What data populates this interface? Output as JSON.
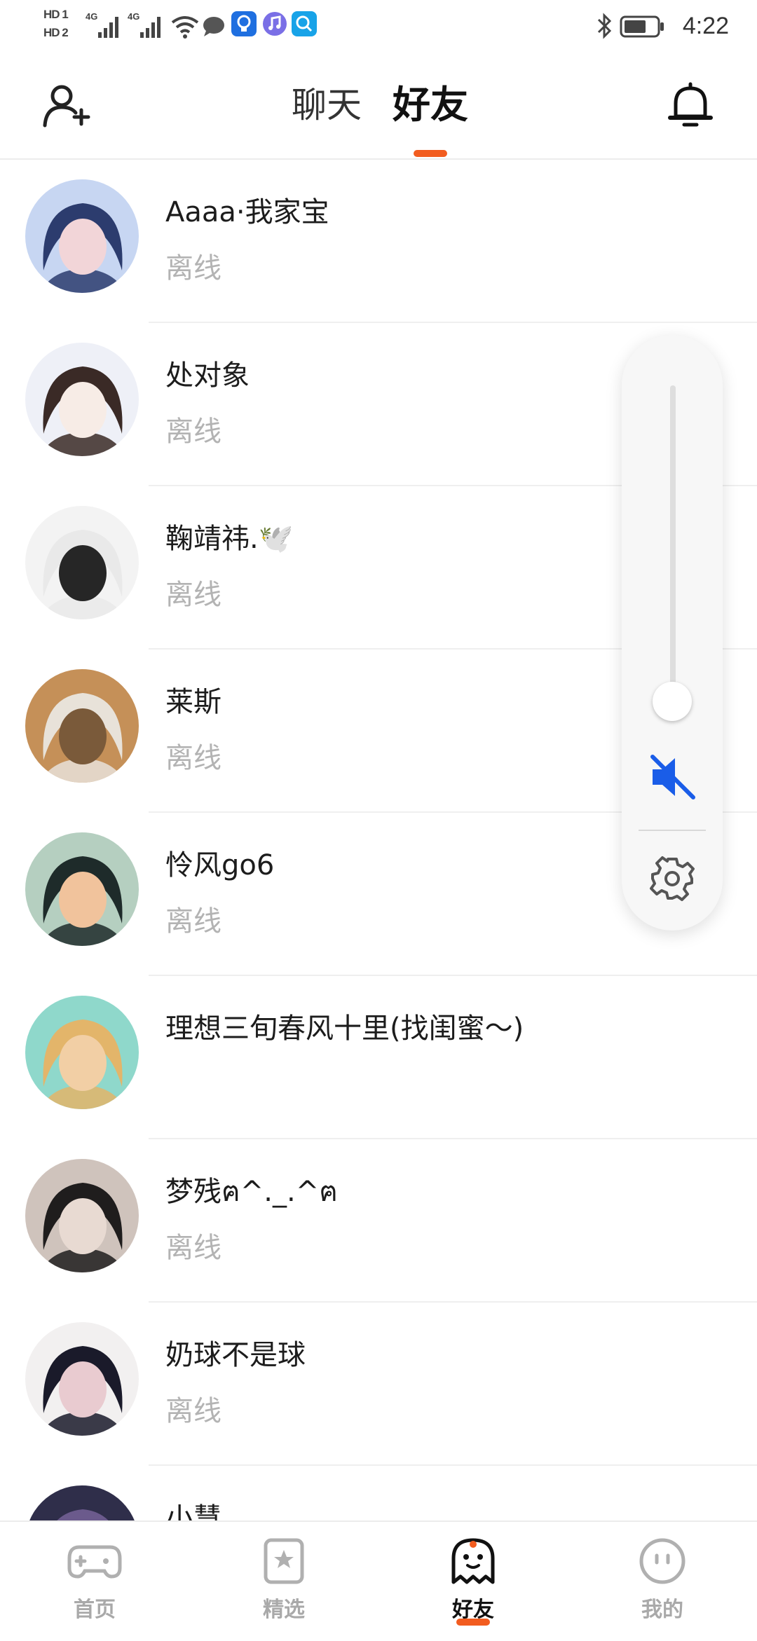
{
  "status_bar": {
    "time": "4:22",
    "hd1": "HD 1",
    "hd2": "HD 2",
    "net1": "4G",
    "net2": "4G",
    "icons": [
      "signal-icon",
      "signal-icon",
      "wifi-icon",
      "message-icon",
      "bulb-app-icon",
      "music-app-icon",
      "search-app-icon",
      "bluetooth-icon",
      "battery-icon"
    ]
  },
  "header": {
    "tabs": [
      {
        "label": "聊天",
        "active": false
      },
      {
        "label": "好友",
        "active": true
      }
    ],
    "accent_color": "#f25c1f"
  },
  "friends": [
    {
      "name": "Aaaa·我家宝",
      "status": "离线",
      "avatar_colors": [
        "#c7d6f2",
        "#2c3c6e",
        "#f2d5d8"
      ]
    },
    {
      "name": "处对象",
      "status": "离线",
      "avatar_colors": [
        "#eef0f7",
        "#3a2a26",
        "#f7ece6"
      ]
    },
    {
      "name": "鞠靖祎.🕊️",
      "status": "离线",
      "avatar_colors": [
        "#f3f3f3",
        "#e9e9e9",
        "#262626"
      ]
    },
    {
      "name": "莱斯",
      "status": "离线",
      "avatar_colors": [
        "#c59058",
        "#e8e2d9",
        "#7a5a3a"
      ]
    },
    {
      "name": "怜风go6",
      "status": "离线",
      "avatar_colors": [
        "#b5cfc0",
        "#1e2b2a",
        "#f1c39c"
      ]
    },
    {
      "name": "理想三旬春风十里(找闺蜜～)",
      "status": "",
      "avatar_colors": [
        "#8fd8cb",
        "#e3b56a",
        "#f2cfa5"
      ]
    },
    {
      "name": "梦残ฅ^._.^ฅ",
      "status": "离线",
      "avatar_colors": [
        "#cfc3bc",
        "#1f1d1d",
        "#e8dad2"
      ]
    },
    {
      "name": "奶球不是球",
      "status": "离线",
      "avatar_colors": [
        "#f2f0f0",
        "#1a1a2a",
        "#e9cbd0"
      ]
    },
    {
      "name": "小慧",
      "status": "",
      "avatar_colors": [
        "#2f2e4a",
        "#6b5a8c",
        "#d7c6e6"
      ]
    }
  ],
  "volume_panel": {
    "level": 0.04,
    "muted": true,
    "mute_color": "#1a5de8"
  },
  "bottom_nav": [
    {
      "label": "首页",
      "icon": "gamepad-icon",
      "active": false
    },
    {
      "label": "精选",
      "icon": "star-card-icon",
      "active": false
    },
    {
      "label": "好友",
      "icon": "ghost-icon",
      "active": true
    },
    {
      "label": "我的",
      "icon": "face-icon",
      "active": false
    }
  ]
}
